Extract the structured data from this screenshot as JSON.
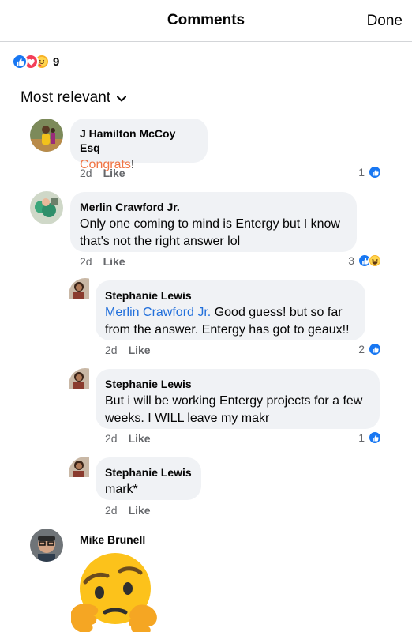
{
  "header": {
    "title": "Comments",
    "done_label": "Done"
  },
  "reactions": {
    "count": "9",
    "types": [
      "like",
      "love",
      "care"
    ]
  },
  "sort": {
    "label": "Most relevant"
  },
  "comments": [
    {
      "name": "J Hamilton McCoy Esq",
      "text_highlight": "Congrats",
      "text_rest": "!",
      "time": "2d",
      "like_label": "Like",
      "reaction_count": "1",
      "reactions": [
        "like"
      ]
    },
    {
      "name": "Merlin Crawford Jr.",
      "text": "Only one coming to mind is Entergy but I know that's not the right answer lol",
      "time": "2d",
      "like_label": "Like",
      "reaction_count": "3",
      "reactions": [
        "like",
        "haha"
      ]
    },
    {
      "name": "Stephanie Lewis",
      "mention": "Merlin Crawford Jr.",
      "text": " Good guess! but so far from the answer. Entergy has got to geaux!!",
      "time": "2d",
      "like_label": "Like",
      "reaction_count": "2",
      "reactions": [
        "like"
      ]
    },
    {
      "name": "Stephanie Lewis",
      "text": "But i will be working Entergy projects for a few weeks. I WILL leave my makr",
      "time": "2d",
      "like_label": "Like",
      "reaction_count": "1",
      "reactions": [
        "like"
      ]
    },
    {
      "name": "Stephanie Lewis",
      "text": "mark*",
      "time": "2d",
      "like_label": "Like"
    },
    {
      "name": "Mike Brunell",
      "emoji": "thinking-face"
    }
  ],
  "colors": {
    "like_blue": "#1877f2",
    "love_red": "#f33e58",
    "care_yellow": "#f7b125",
    "mention_blue": "#216fdb",
    "congrats_orange": "#f07545",
    "bubble_bg": "#f0f2f5"
  }
}
